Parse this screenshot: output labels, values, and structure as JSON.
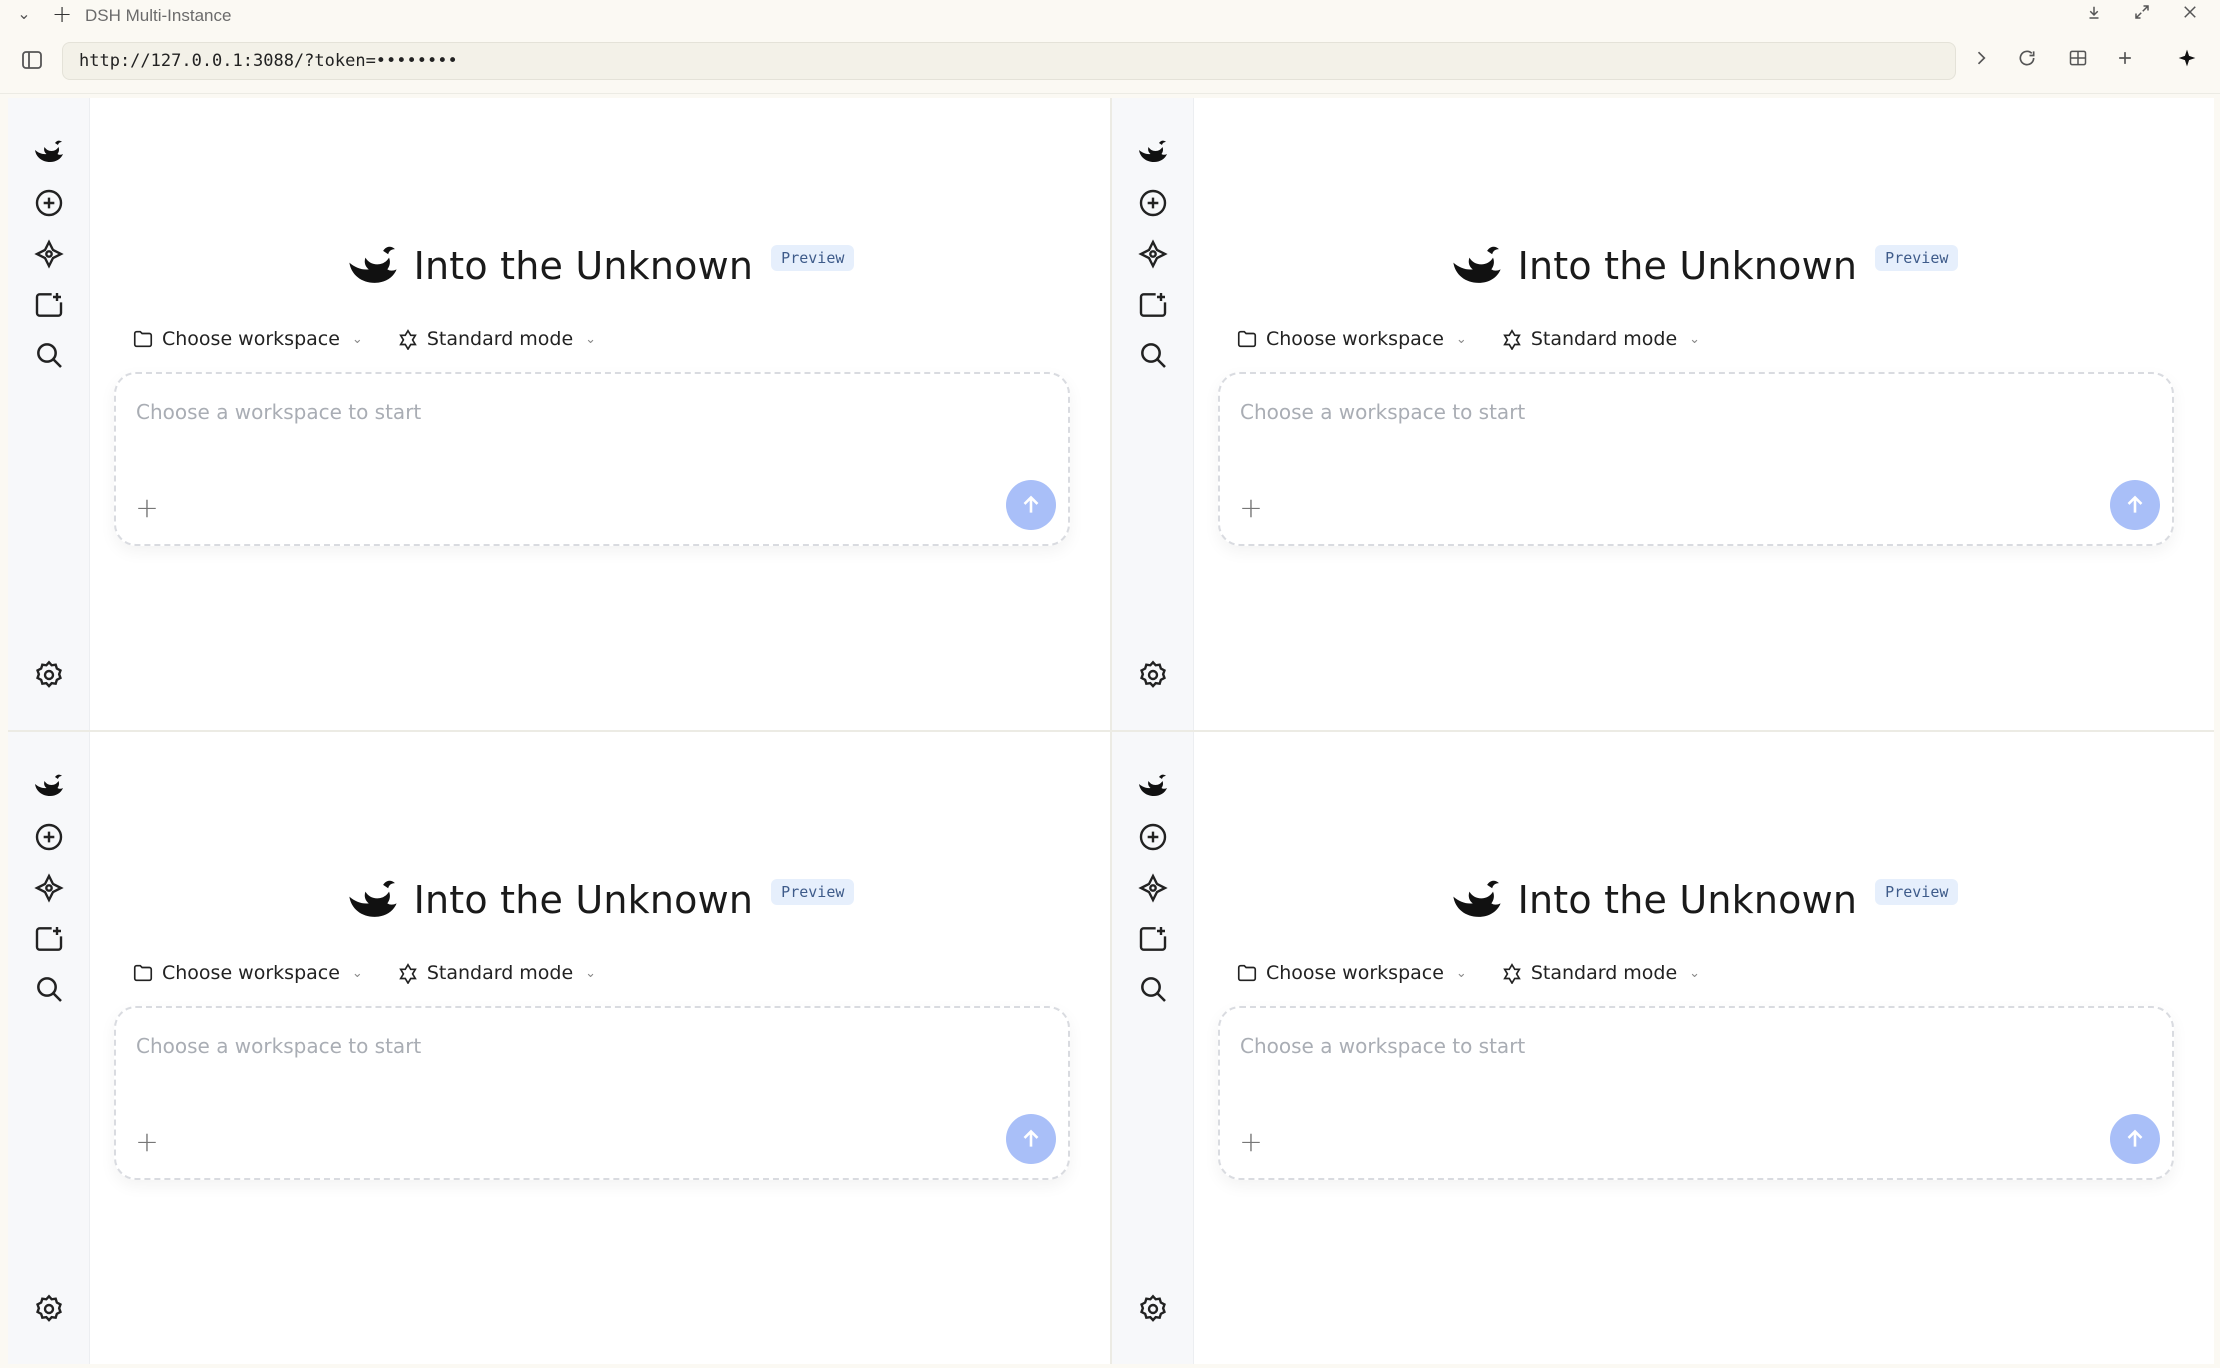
{
  "browser": {
    "tab_title": "DSH Multi-Instance",
    "url": "http://127.0.0.1:3088/?token=••••••••"
  },
  "app": {
    "title": "Into the Unknown",
    "badge": "Preview",
    "workspace_label": "Choose workspace",
    "mode_label": "Standard mode",
    "input_placeholder": "Choose a workspace to start"
  },
  "colors": {
    "send_button": "#a9bff8",
    "badge_bg": "#e6effc",
    "badge_text": "#3e5b8a",
    "rail_bg": "#f7f8fa"
  },
  "panes": [
    {
      "id": 1
    },
    {
      "id": 2
    },
    {
      "id": 3
    },
    {
      "id": 4
    }
  ]
}
